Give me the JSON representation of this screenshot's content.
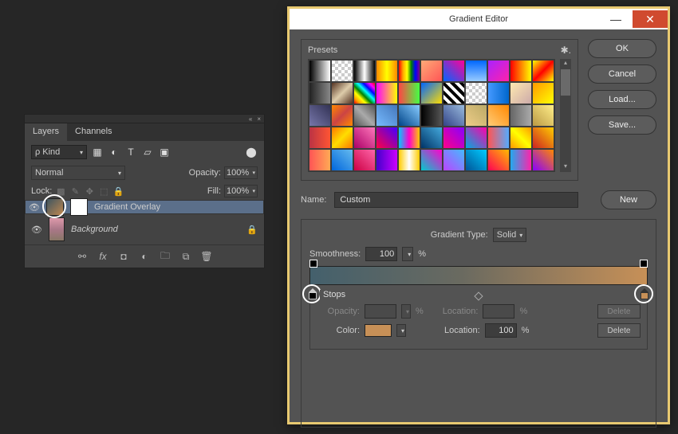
{
  "layers_panel": {
    "collapse_icon": "«",
    "close_icon": "×",
    "tabs": [
      "Layers",
      "Channels"
    ],
    "kind_label": "Kind",
    "blend_mode": "Normal",
    "opacity_label": "Opacity:",
    "opacity_value": "100%",
    "lock_label": "Lock:",
    "fill_label": "Fill:",
    "fill_value": "100%",
    "layers": [
      {
        "name": "Gradient Overlay",
        "locked": false
      },
      {
        "name": "Background",
        "locked": true
      }
    ]
  },
  "gradient_editor": {
    "title": "Gradient Editor",
    "minimize": "—",
    "close": "✕",
    "presets_label": "Presets",
    "buttons": {
      "ok": "OK",
      "cancel": "Cancel",
      "load": "Load...",
      "save": "Save...",
      "new": "New"
    },
    "name_label": "Name:",
    "name_value": "Custom",
    "gradient_type_label": "Gradient Type:",
    "gradient_type_value": "Solid",
    "smoothness_label": "Smoothness:",
    "smoothness_value": "100",
    "smoothness_unit": "%",
    "stops": {
      "label": "Stops",
      "opacity_label": "Opacity:",
      "opacity_value": "",
      "opacity_unit": "%",
      "o_location_label": "Location:",
      "o_location_value": "",
      "o_location_unit": "%",
      "o_delete": "Delete",
      "color_label": "Color:",
      "color_value": "#c79057",
      "c_location_label": "Location:",
      "c_location_value": "100",
      "c_location_unit": "%",
      "c_delete": "Delete"
    },
    "presets": [
      "linear-gradient(90deg,#000,#fff)",
      "repeating-conic-gradient(#ccc 0 25%,#fff 0 50%) 0 0/8px 8px",
      "linear-gradient(90deg,#000,#fff,#000)",
      "linear-gradient(90deg,#f80,#ff0,#f80)",
      "linear-gradient(90deg,red,orange,yellow,green,blue,purple)",
      "linear-gradient(135deg,#fa7,#f55)",
      "linear-gradient(45deg,#06f,#f09)",
      "linear-gradient(180deg,#06f,#9cf)",
      "linear-gradient(135deg,#a2f,#f2a)",
      "linear-gradient(90deg,#f00,#ff0)",
      "linear-gradient(135deg,#ff0,#f00,#ff0)",
      "linear-gradient(90deg,#222,#888)",
      "linear-gradient(135deg,#532,#dca,#532)",
      "linear-gradient(45deg,red,orange,yellow,green,cyan,blue,magenta,red)",
      "linear-gradient(90deg,#f0f,#ff0)",
      "linear-gradient(90deg,#f44,#4f4)",
      "linear-gradient(135deg,#06f,#fd0)",
      "repeating-linear-gradient(45deg,#000 0 4px,#fff 4px 8px)",
      "repeating-conic-gradient(#ccc 0 25%,#fff 0 50%) 0 0/8px 8px",
      "linear-gradient(90deg,#49f,#06c)",
      "linear-gradient(135deg,#ffe9b0,#caa)",
      "linear-gradient(135deg,#f90,#ff0)",
      "linear-gradient(45deg,#77a,#335)",
      "linear-gradient(135deg,#f80,#c44,#f80)",
      "linear-gradient(45deg,#555,#aaa,#555)",
      "linear-gradient(45deg,#7bf,#47b)",
      "linear-gradient(45deg,#048,#8cf)",
      "linear-gradient(90deg,#000,#555)",
      "linear-gradient(45deg,#348,#9bd)",
      "linear-gradient(45deg,#ec8,#ba6)",
      "linear-gradient(45deg,#fc7,#f80)",
      "linear-gradient(90deg,#666,#aaa)",
      "linear-gradient(45deg,#b94,#fe8)",
      "linear-gradient(90deg,#b34,#f53)",
      "linear-gradient(135deg,#f70,#fd0,#f70)",
      "linear-gradient(45deg,#a06,#f7b)",
      "linear-gradient(45deg,#f04,#40f)",
      "linear-gradient(90deg,#0cf,#f0c,#fc0)",
      "linear-gradient(45deg,#036,#4ad)",
      "linear-gradient(45deg,#f08,#80f)",
      "linear-gradient(45deg,#0ad,#f0a)",
      "linear-gradient(90deg,#f55,#5af)",
      "linear-gradient(45deg,#f90,#ff0,#f90)",
      "linear-gradient(45deg,#c22,#fc0)",
      "linear-gradient(90deg,#f55,#fa5)",
      "linear-gradient(45deg,#06d,#6be)",
      "linear-gradient(45deg,#c04,#f6a)",
      "linear-gradient(90deg,#40c,#c0f)",
      "linear-gradient(90deg,#fc0,#fff,#fc0)",
      "linear-gradient(45deg,#0cc,#f0c)",
      "linear-gradient(45deg,#b4f,#4bf)",
      "linear-gradient(45deg,#059,#0cf)",
      "linear-gradient(45deg,#f05,#fb0)",
      "linear-gradient(90deg,#2ae,#f2a)",
      "linear-gradient(45deg,#80f,#f80)"
    ]
  }
}
